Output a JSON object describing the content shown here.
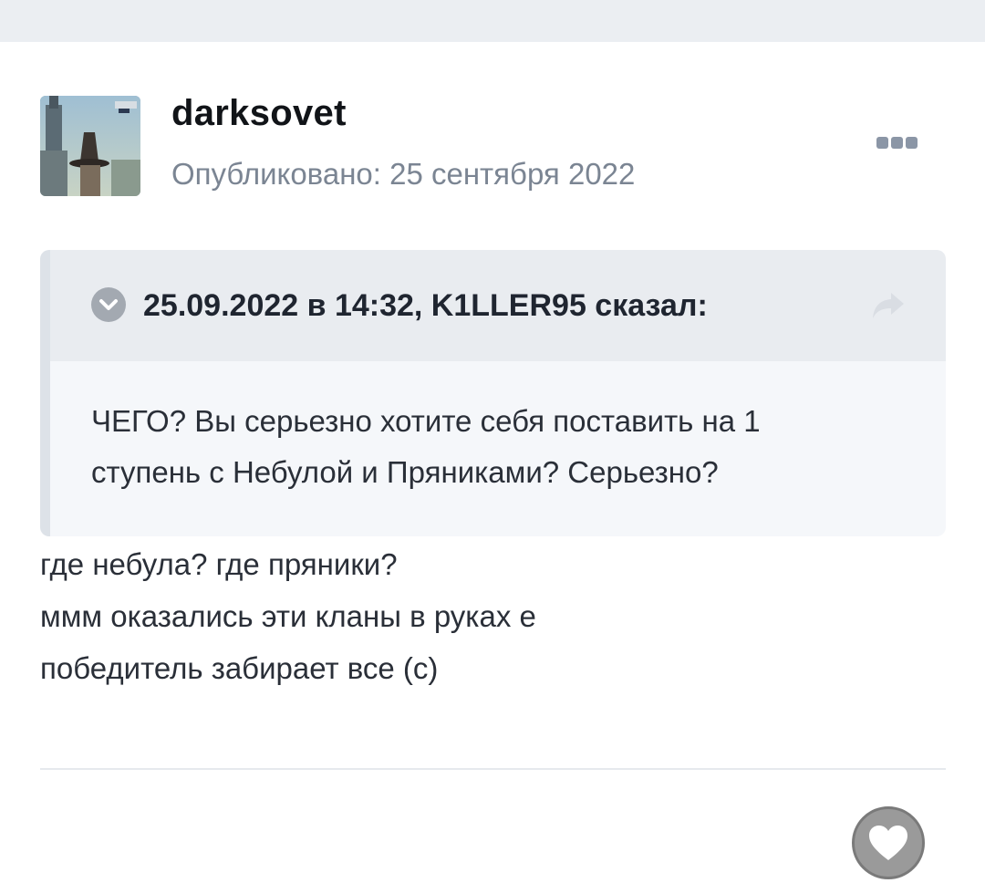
{
  "post": {
    "author": "darksovet",
    "published": "Опубликовано: 25 сентября 2022",
    "more_icon": "ellipsis-icon",
    "quote": {
      "citation": "25.09.2022 в 14:32, K1LLER95 сказал:",
      "body_lines": [
        "ЧЕГО? Вы серьезно хотите себя поставить на 1",
        "ступень с Небулой и Пряниками? Серьезно?"
      ],
      "collapse_icon": "chevron-down-circle-icon",
      "share_icon": "share-arrow-icon"
    },
    "content_lines": [
      "где небула? где пряники?",
      "ммм оказались эти кланы в руках е",
      "победитель забирает все (с)"
    ],
    "like_icon": "heart-icon"
  },
  "colors": {
    "page_band": "#ebeef2",
    "text_primary": "#111418",
    "text_muted": "#7b8593",
    "quote_header": "#e9ecf0",
    "quote_body": "#f5f7fa",
    "like_button": "#9a9a9a"
  }
}
